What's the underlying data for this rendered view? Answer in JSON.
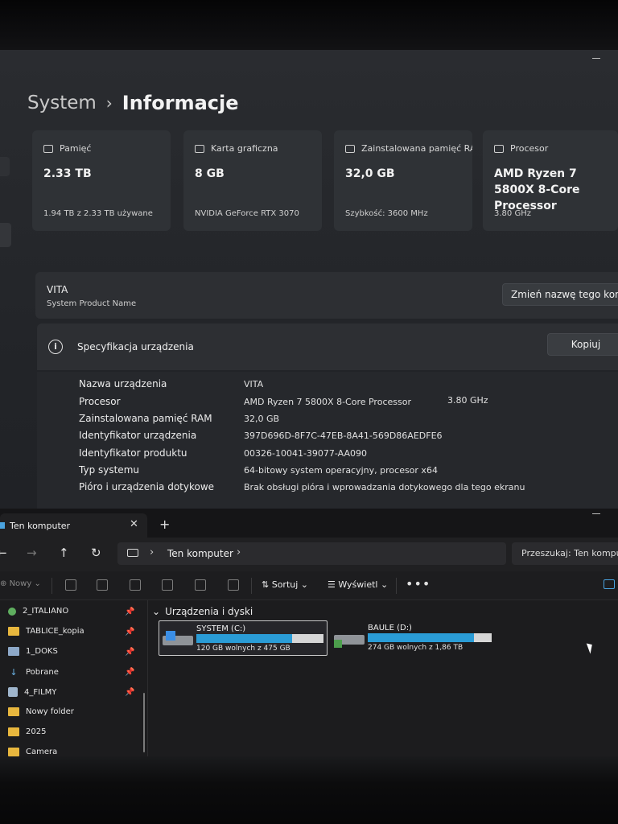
{
  "settings": {
    "breadcrumb": {
      "parent": "System",
      "separator": "›",
      "current": "Informacje"
    },
    "cards": [
      {
        "header": "Pamięć",
        "value": "2.33 TB",
        "sub": "1.94 TB z 2.33 TB używane",
        "icon": "storage-icon"
      },
      {
        "header": "Karta graficzna",
        "value": "8 GB",
        "sub": "NVIDIA GeForce RTX 3070",
        "icon": "gpu-icon"
      },
      {
        "header": "Zainstalowana pamięć RAM",
        "value": "32,0 GB",
        "sub": "Szybkość: 3600 MHz",
        "icon": "ram-icon"
      },
      {
        "header": "Procesor",
        "value": "AMD Ryzen 7 5800X 8-Core Processor",
        "sub": "3.80 GHz",
        "icon": "cpu-icon"
      }
    ],
    "device_name": {
      "name": "VITA",
      "label": "System Product Name",
      "rename_button": "Zmień nazwę tego komputera"
    },
    "spec": {
      "title": "Specyfikacja urządzenia",
      "copy_button": "Kopiuj",
      "rows": [
        {
          "key": "Nazwa urządzenia",
          "value": "VITA"
        },
        {
          "key": "Procesor",
          "value": "AMD Ryzen 7 5800X 8-Core Processor",
          "extra": "3.80 GHz"
        },
        {
          "key": "Zainstalowana pamięć RAM",
          "value": "32,0 GB"
        },
        {
          "key": "Identyfikator urządzenia",
          "value": "397D696D-8F7C-47EB-8A41-569D86AEDFE6"
        },
        {
          "key": "Identyfikator produktu",
          "value": "00326-10041-39077-AA090"
        },
        {
          "key": "Typ systemu",
          "value": "64-bitowy system operacyjny, procesor x64"
        },
        {
          "key": "Pióro i urządzenia dotykowe",
          "value": "Brak obsługi pióra i wprowadzania dotykowego dla tego ekranu"
        }
      ]
    }
  },
  "explorer": {
    "tab": {
      "label": "Ten komputer",
      "close": "✕",
      "add": "+"
    },
    "nav": {
      "back": "←",
      "forward": "→",
      "up": "↑",
      "refresh": "↻"
    },
    "address": {
      "location": "Ten komputer",
      "sep": "›"
    },
    "search": {
      "placeholder": "Przeszukaj: Ten komputer"
    },
    "toolbar": {
      "new": "Nowy",
      "sort": "Sortuj",
      "view": "Wyświetl",
      "more": "•••"
    },
    "sidebar": [
      {
        "label": "2_ITALIANO",
        "icon": "network-folder-icon",
        "pinned": true
      },
      {
        "label": "TABLICE_kopia",
        "icon": "folder-icon",
        "pinned": true
      },
      {
        "label": "1_DOKS",
        "icon": "documents-icon",
        "pinned": true
      },
      {
        "label": "Pobrane",
        "icon": "download-icon",
        "pinned": true
      },
      {
        "label": "4_FILMY",
        "icon": "videos-icon",
        "pinned": true
      },
      {
        "label": "Nowy folder",
        "icon": "folder-icon",
        "pinned": false
      },
      {
        "label": "2025",
        "icon": "folder-icon",
        "pinned": false
      },
      {
        "label": "Camera",
        "icon": "folder-icon",
        "pinned": false
      }
    ],
    "pin_glyph": "📌",
    "group_title": "Urządzenia i dyski",
    "drives": [
      {
        "name": "SYSTEM (C:)",
        "free": "120 GB wolnych z 475 GB",
        "used_fraction": 0.75,
        "selected": true
      },
      {
        "name": "BAULE (D:)",
        "free": "274 GB wolnych z 1,86 TB",
        "used_fraction": 0.86,
        "selected": false
      }
    ]
  },
  "colors": {
    "accent": "#2a9cd6",
    "folder": "#e8b73e",
    "panel": "#2f3236"
  }
}
